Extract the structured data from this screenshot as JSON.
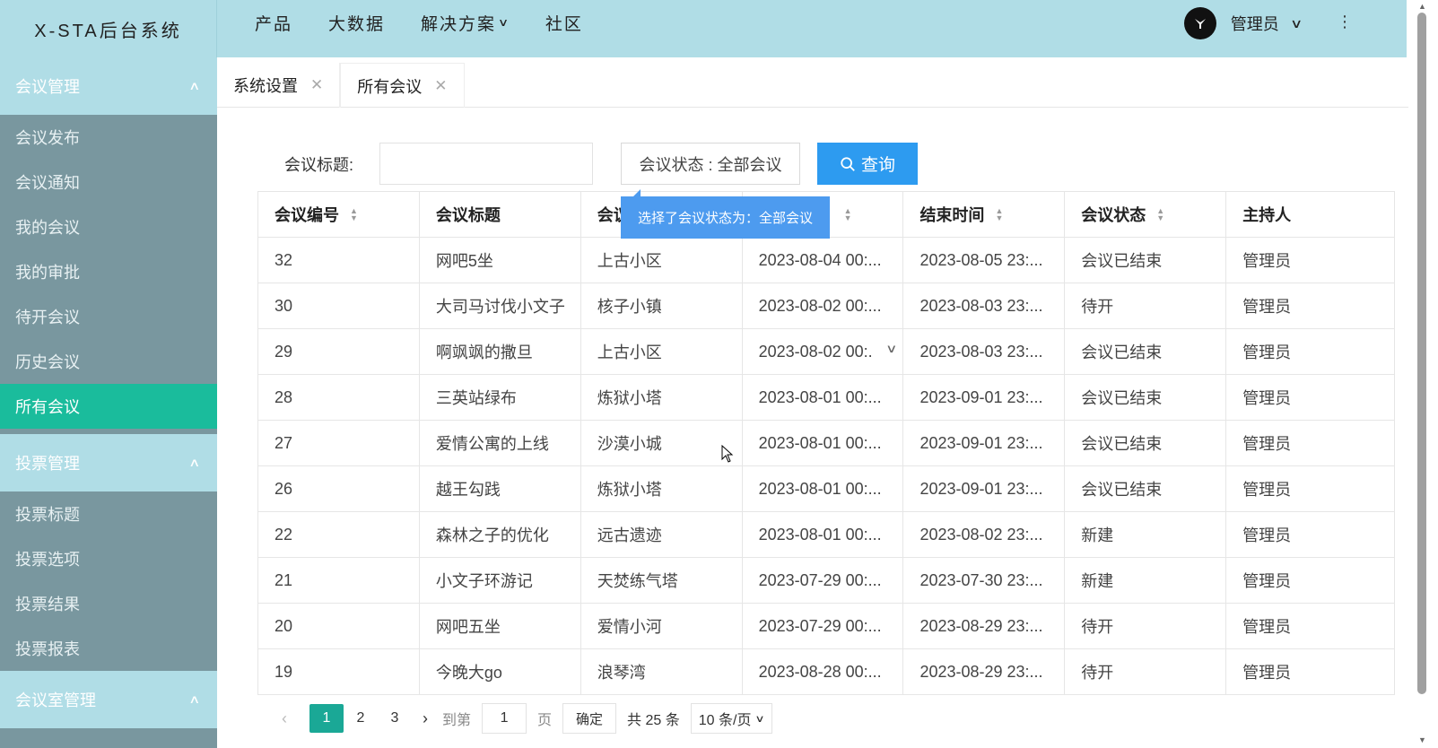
{
  "app": {
    "title": "X-STA后台系统"
  },
  "topnav": {
    "items": [
      {
        "label": "产品"
      },
      {
        "label": "大数据"
      },
      {
        "label": "解决方案",
        "has_dropdown": true
      },
      {
        "label": "社区"
      }
    ]
  },
  "user": {
    "name": "管理员"
  },
  "sidebar": {
    "groups": [
      {
        "label": "会议管理",
        "items": [
          "会议发布",
          "会议通知",
          "我的会议",
          "我的审批",
          "待开会议",
          "历史会议",
          "所有会议"
        ],
        "active": "所有会议"
      },
      {
        "label": "投票管理",
        "items": [
          "投票标题",
          "投票选项",
          "投票结果",
          "投票报表"
        ]
      },
      {
        "label": "会议室管理",
        "items": []
      }
    ]
  },
  "tabs": [
    {
      "label": "系统设置"
    },
    {
      "label": "所有会议",
      "active": true
    }
  ],
  "search": {
    "title_label": "会议标题:",
    "title_value": "",
    "status_select": "会议状态 : 全部会议",
    "query_label": "查询"
  },
  "tooltip": {
    "text": "选择了会议状态为：全部会议"
  },
  "table": {
    "columns": [
      "会议编号",
      "会议标题",
      "会议",
      "",
      "结束时间",
      "会议状态",
      "主持人"
    ],
    "rows": [
      [
        "32",
        "网吧5坐",
        "上古小区",
        "2023-08-04 00:...",
        "2023-08-05 23:...",
        "会议已结束",
        "管理员"
      ],
      [
        "30",
        "大司马讨伐小文子",
        "核子小镇",
        "2023-08-02 00:...",
        "2023-08-03 23:...",
        "待开",
        "管理员"
      ],
      [
        "29",
        "啊飒飒的撒旦",
        "上古小区",
        "2023-08-02 00:.",
        "2023-08-03 23:...",
        "会议已结束",
        "管理员"
      ],
      [
        "28",
        "三英站绿布",
        "炼狱小塔",
        "2023-08-01 00:...",
        "2023-09-01 23:...",
        "会议已结束",
        "管理员"
      ],
      [
        "27",
        "爱情公寓的上线",
        "沙漠小城",
        "2023-08-01 00:...",
        "2023-09-01 23:...",
        "会议已结束",
        "管理员"
      ],
      [
        "26",
        "越王勾践",
        "炼狱小塔",
        "2023-08-01 00:...",
        "2023-09-01 23:...",
        "会议已结束",
        "管理员"
      ],
      [
        "22",
        "森林之子的优化",
        "远古遗迹",
        "2023-08-01 00:...",
        "2023-08-02 23:...",
        "新建",
        "管理员"
      ],
      [
        "21",
        "小文子环游记",
        "天焚练气塔",
        "2023-07-29 00:...",
        "2023-07-30 23:...",
        "新建",
        "管理员"
      ],
      [
        "20",
        "网吧五坐",
        "爱情小河",
        "2023-07-29 00:...",
        "2023-08-29 23:...",
        "待开",
        "管理员"
      ],
      [
        "19",
        "今晚大go",
        "浪琴湾",
        "2023-08-28 00:...",
        "2023-08-29 23:...",
        "待开",
        "管理员"
      ]
    ]
  },
  "pager": {
    "pages": [
      "1",
      "2",
      "3"
    ],
    "current": "1",
    "goto_label": "到第",
    "goto_value": "1",
    "page_suffix": "页",
    "confirm_label": "确定",
    "total": "共 25 条",
    "page_size": "10 条/页"
  },
  "colors": {
    "header": "#b0dde6",
    "sidebar": "#79979f",
    "active": "#1abc9c",
    "primary": "#2d9bf0"
  }
}
